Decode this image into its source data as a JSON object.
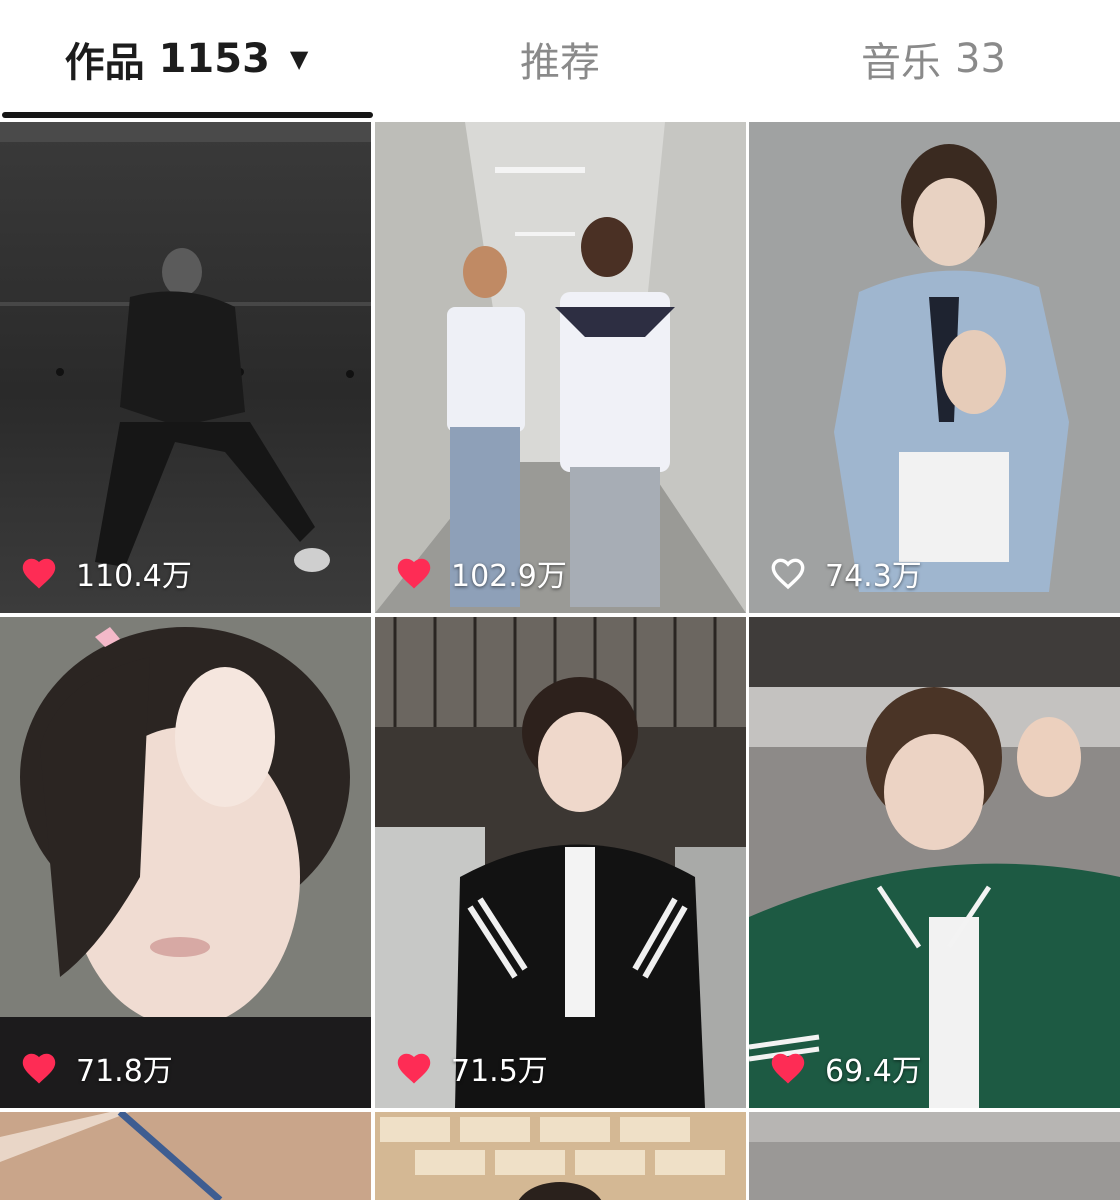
{
  "tabs": [
    {
      "label": "作品",
      "count": "1153",
      "active": true,
      "has_dropdown": true
    },
    {
      "label": "推荐",
      "count": "",
      "active": false
    },
    {
      "label": "音乐",
      "count": "33",
      "active": false
    }
  ],
  "grid": {
    "items": [
      {
        "likes": "110.4万",
        "liked": true,
        "image": "dancer-black-white"
      },
      {
        "likes": "102.9万",
        "liked": true,
        "image": "two-people-hallway"
      },
      {
        "likes": "74.3万",
        "liked": false,
        "image": "denim-shirt-pose"
      },
      {
        "likes": "71.8万",
        "liked": true,
        "image": "closeup-filter"
      },
      {
        "likes": "71.5万",
        "liked": true,
        "image": "black-track-jacket"
      },
      {
        "likes": "69.4万",
        "liked": true,
        "image": "green-varsity-jacket"
      },
      {
        "image": "partial-bottom-left"
      },
      {
        "image": "partial-bottom-middle"
      },
      {
        "image": "partial-bottom-right"
      }
    ]
  },
  "colors": {
    "heart_filled": "#fe2c55",
    "heart_outline": "#ffffff",
    "tab_active": "#1c1c1c",
    "tab_inactive": "#8a8a8a"
  }
}
